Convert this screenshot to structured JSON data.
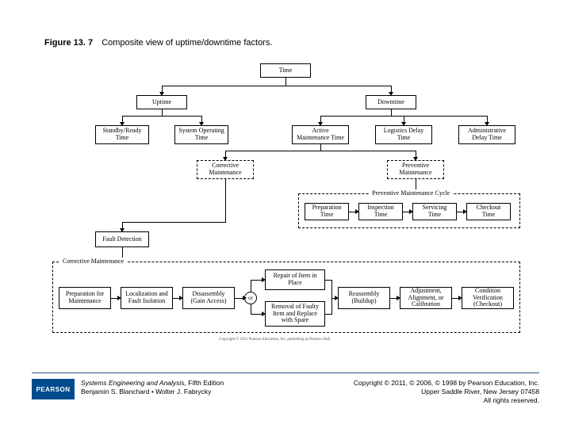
{
  "caption": {
    "fignum": "Figure 13. 7",
    "title": "Composite view of uptime/downtime factors."
  },
  "nodes": {
    "time": "Time",
    "uptime": "Uptime",
    "downtime": "Downtime",
    "standby": "Standby/Ready Time",
    "sysop": "System Operating Time",
    "active_maint": "Active Maintenance Time",
    "log_delay": "Logistics Delay Time",
    "admin_delay": "Administrative Delay Time",
    "corrective": "Corrective Maintenance",
    "preventive": "Preventive Maintenance",
    "pm_cycle_label": "Preventive Maintenance Cycle",
    "pm_prep": "Preparation Time",
    "pm_insp": "Inspection Time",
    "pm_serv": "Servicing Time",
    "pm_check": "Checkout Time",
    "fault_det": "Fault Detection",
    "cm_cycle_label": "Corrective Maintenance",
    "cm_prep": "Preparation for Maintenance",
    "cm_loc": "Localization and Fault Isolation",
    "cm_dis": "Disassembly (Gain Access)",
    "cm_rep_place": "Repair of Item in Place",
    "cm_rep_swap": "Removal of Faulty Item and Replace with Spare",
    "cm_or": "or",
    "cm_reass": "Reassembly (Buildup)",
    "cm_adj": "Adjustment, Alignment, or Calibration",
    "cm_ver": "Condition Verification (Checkout)"
  },
  "tiny_copyright": "Copyright © 2011 Pearson Education, Inc. publishing as Prentice Hall",
  "footer": {
    "logo": "PEARSON",
    "book_title": "Systems Engineering and Analysis,",
    "edition": "Fifth Edition",
    "authors": "Benjamin S. Blanchard • Wolter J. Fabrycky",
    "copy1": "Copyright © 2011, © 2006, © 1998 by Pearson Education, Inc.",
    "copy2": "Upper Saddle River, New Jersey 07458",
    "copy3": "All rights reserved."
  }
}
